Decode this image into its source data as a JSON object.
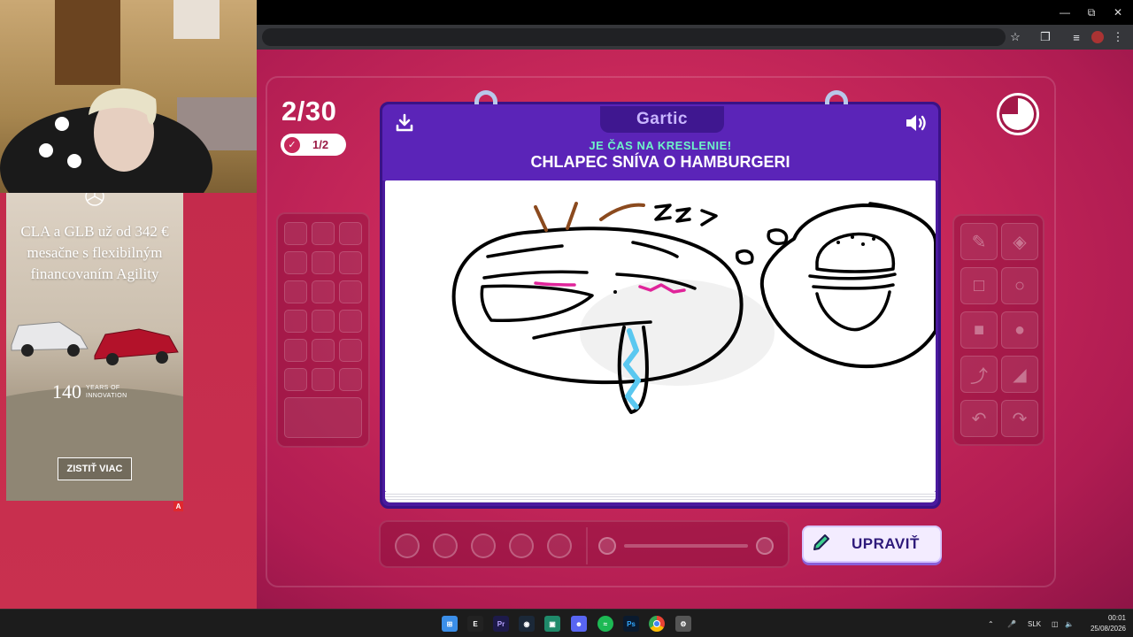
{
  "game": {
    "round_counter": "2/30",
    "done_badge": "1/2",
    "logo": "Gartic",
    "prompt_label": "JE ČAS NA KRESLENIE!",
    "prompt_text": "CHLAPEC SNÍVA O HAMBURGERI",
    "edit_button": "UPRAVIŤ",
    "icons": {
      "download": "download-icon",
      "volume": "volume-icon",
      "timer": "timer-icon",
      "edit": "pencil-icon"
    },
    "colors": {
      "background": "#c8285a",
      "notebook": "#5b24b8",
      "prompt_label": "#6ef5c8",
      "button": "#f3ecff"
    }
  },
  "ad": {
    "headline_1": "CLA a GLB už od 342 €",
    "headline_2": "mesačne s flexibilným",
    "headline_3": "financovaním Agility",
    "years_number": "140",
    "years_line_1": "YEARS OF",
    "years_line_2": "INNOVATION",
    "cta": "ZISTIŤ VIAC",
    "badge": "A"
  },
  "taskbar": {
    "language": "SLK",
    "time": "00:01",
    "date": "25/08/2026"
  }
}
